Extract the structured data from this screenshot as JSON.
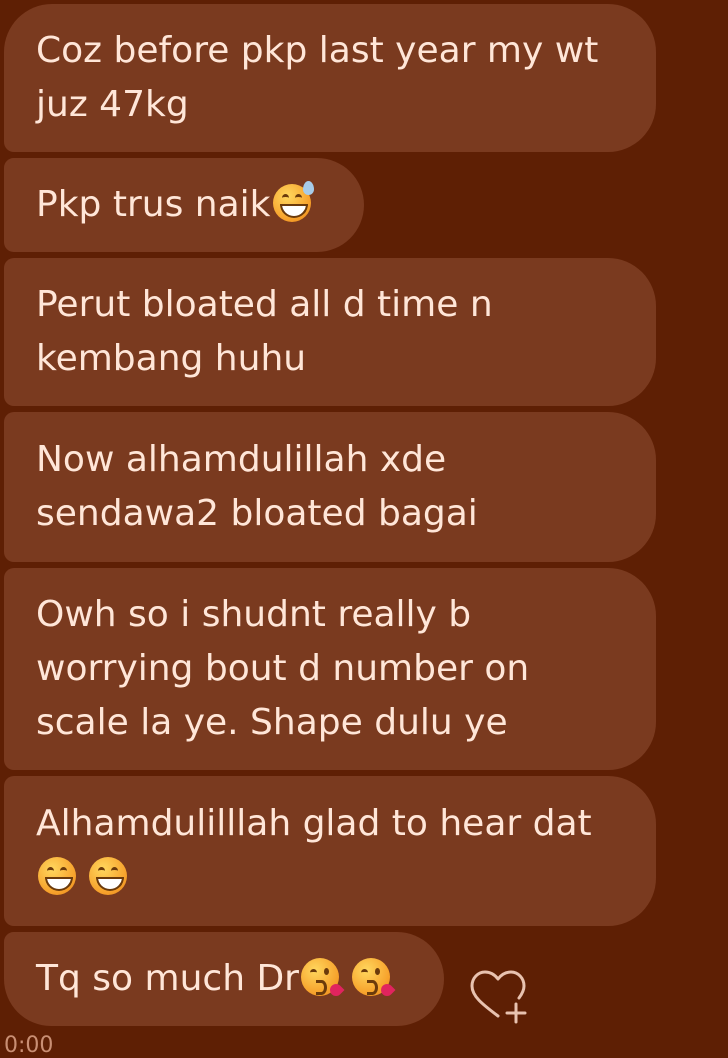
{
  "messages": [
    {
      "lines": [
        "Coz before pkp last year my wt",
        "juz 47kg"
      ],
      "emoji": []
    },
    {
      "lines": [
        "Pkp trus naik"
      ],
      "emoji": [
        "grinning-sweat-emoji"
      ]
    },
    {
      "lines": [
        "Perut bloated all d time n",
        "kembang huhu"
      ],
      "emoji": []
    },
    {
      "lines": [
        "Now alhamdulillah xde",
        "sendawa2 bloated bagai"
      ],
      "emoji": []
    },
    {
      "lines": [
        "Owh so i shudnt really b",
        "worrying bout d number on",
        "scale la ye. Shape dulu ye"
      ],
      "emoji": []
    },
    {
      "lines": [
        "Alhamdulilllah glad to hear dat"
      ],
      "emoji": [
        "grinning-emoji",
        "grinning-emoji"
      ]
    },
    {
      "lines": [
        "Tq so much Dr"
      ],
      "emoji": [
        "kissing-emoji",
        "kissing-emoji"
      ]
    }
  ],
  "timestamp": "0:00",
  "colors": {
    "background": "#5e1f04",
    "bubble": "#7a3a1f",
    "text": "#ffe6d8"
  },
  "icons": {
    "react": "heart-plus-icon"
  }
}
